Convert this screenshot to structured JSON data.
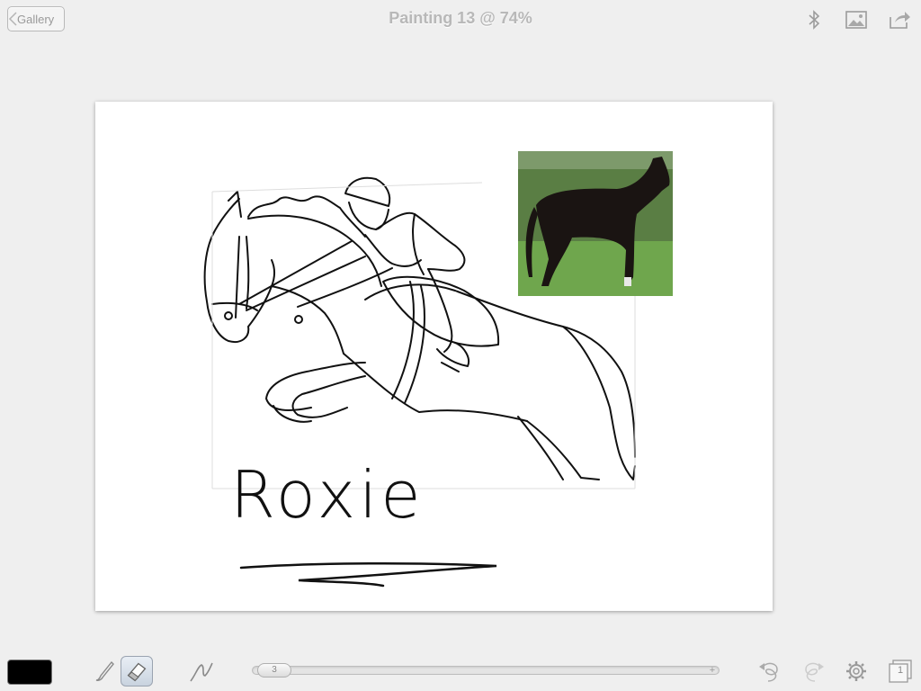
{
  "topbar": {
    "gallery_label": "Gallery",
    "title": "Painting 13 @ 74%",
    "icons": [
      "bluetooth-icon",
      "image-icon",
      "share-icon"
    ]
  },
  "canvas": {
    "signature_text": "Roxie",
    "reference_photo": "black-horse-photo"
  },
  "toolbar": {
    "current_color": "#000000",
    "tools": [
      "brush-icon",
      "eraser-icon",
      "smudge-icon"
    ],
    "active_tool": "eraser-icon",
    "brush_size": "3",
    "layer_count": "1",
    "right_icons": [
      "undo-icon",
      "redo-icon",
      "settings-gear-icon",
      "layers-icon"
    ]
  },
  "colors": {
    "background": "#efefef",
    "canvas": "#ffffff",
    "title": "#b8b8b8"
  }
}
